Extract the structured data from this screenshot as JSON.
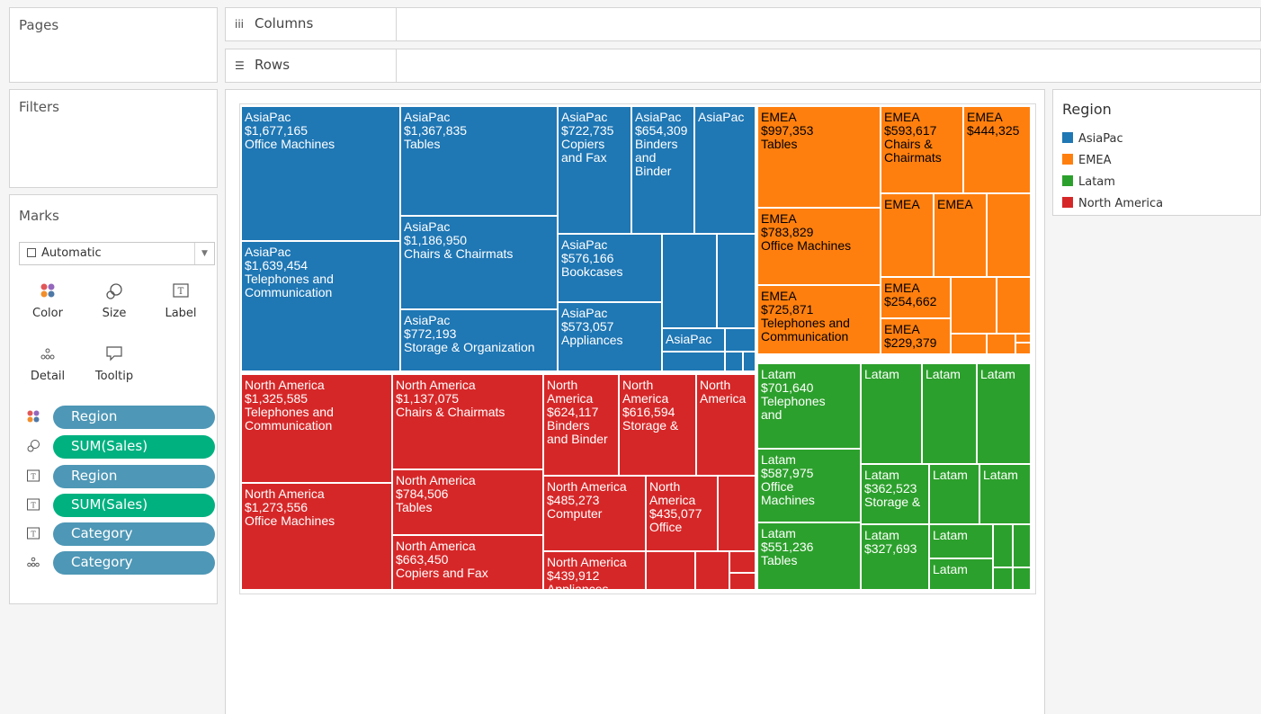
{
  "panels": {
    "pages": "Pages",
    "filters": "Filters",
    "marks": "Marks"
  },
  "shelves": {
    "columns": "Columns",
    "rows": "Rows"
  },
  "marks_card": {
    "mark_type": "Automatic",
    "buttons": [
      "Color",
      "Size",
      "Label",
      "Detail",
      "Tooltip"
    ],
    "pills": [
      {
        "icon": "color-icon",
        "label": "Region",
        "kind": "dimension"
      },
      {
        "icon": "size-icon",
        "label": "SUM(Sales)",
        "kind": "measure"
      },
      {
        "icon": "label-icon",
        "label": "Region",
        "kind": "dimension"
      },
      {
        "icon": "label-icon",
        "label": "SUM(Sales)",
        "kind": "measure"
      },
      {
        "icon": "label-icon",
        "label": "Category",
        "kind": "dimension"
      },
      {
        "icon": "detail-icon",
        "label": "Category",
        "kind": "dimension"
      }
    ]
  },
  "legend": {
    "title": "Region",
    "items": [
      {
        "label": "AsiaPac",
        "color": "#1f77b4"
      },
      {
        "label": "EMEA",
        "color": "#ff7f0e"
      },
      {
        "label": "Latam",
        "color": "#2ca02c"
      },
      {
        "label": "North America",
        "color": "#d62728"
      }
    ]
  },
  "colors": {
    "AsiaPac": "#1f77b4",
    "EMEA": "#ff7f0e",
    "Latam": "#2ca02c",
    "North America": "#d62728"
  },
  "treemap_labels": {
    "ap1": [
      "AsiaPac",
      "$1,677,165",
      "Office Machines"
    ],
    "ap2": [
      "AsiaPac",
      "$1,367,835",
      "Tables"
    ],
    "ap3": [
      "AsiaPac",
      "$722,735",
      "Copiers",
      "and Fax"
    ],
    "ap4": [
      "AsiaPac",
      "$654,309",
      "Binders",
      "and",
      "Binder"
    ],
    "ap5": [
      "AsiaPac"
    ],
    "ap6": [
      "AsiaPac",
      "$1,639,454",
      "Telephones and",
      "Communication"
    ],
    "ap7": [
      "AsiaPac",
      "$1,186,950",
      "Chairs & Chairmats"
    ],
    "ap8": [
      "AsiaPac",
      "$576,166",
      "Bookcases"
    ],
    "ap9": [
      "AsiaPac",
      "$772,193",
      "Storage & Organization"
    ],
    "ap10": [
      "AsiaPac",
      "$573,057",
      "Appliances"
    ],
    "ap11": [
      "AsiaPac"
    ],
    "em1": [
      "EMEA",
      "$997,353",
      "Tables"
    ],
    "em2": [
      "EMEA",
      "$593,617",
      "Chairs &",
      "Chairmats"
    ],
    "em3": [
      "EMEA",
      "$444,325"
    ],
    "em4": [
      "EMEA",
      "$783,829",
      "Office Machines"
    ],
    "em5": [
      "EMEA"
    ],
    "em6": [
      "EMEA"
    ],
    "em7": [
      "EMEA",
      "$725,871",
      "Telephones and",
      "Communication"
    ],
    "em8": [
      "EMEA",
      "$254,662"
    ],
    "em9": [
      "EMEA",
      "$229,379"
    ],
    "la1": [
      "Latam",
      "$701,640",
      "Telephones",
      "and"
    ],
    "la2": [
      "Latam"
    ],
    "la3": [
      "Latam"
    ],
    "la4": [
      "Latam"
    ],
    "la5": [
      "Latam",
      "$587,975",
      "Office",
      "Machines"
    ],
    "la6": [
      "Latam",
      "$362,523",
      "Storage &"
    ],
    "la7": [
      "Latam"
    ],
    "la8": [
      "Latam"
    ],
    "la9": [
      "Latam",
      "$551,236",
      "Tables"
    ],
    "la10": [
      "Latam",
      "$327,693"
    ],
    "la11": [
      "Latam"
    ],
    "la12": [
      "Latam"
    ],
    "na1": [
      "North America",
      "$1,325,585",
      "Telephones and",
      "Communication"
    ],
    "na2": [
      "North America",
      "$1,137,075",
      "Chairs & Chairmats"
    ],
    "na3": [
      "North",
      "America",
      "$624,117",
      "Binders",
      "and Binder"
    ],
    "na4": [
      "North",
      "America",
      "$616,594",
      "Storage &"
    ],
    "na5": [
      "North",
      "America"
    ],
    "na6": [
      "North America",
      "$1,273,556",
      "Office Machines"
    ],
    "na7": [
      "North America",
      "$784,506",
      "Tables"
    ],
    "na8": [
      "North America",
      "$485,273",
      "Computer"
    ],
    "na9": [
      "North",
      "America",
      "$435,077",
      "Office"
    ],
    "na10": [
      "North America",
      "$663,450",
      "Copiers and Fax"
    ],
    "na11": [
      "North America",
      "$439,912",
      "Appliances"
    ]
  }
}
